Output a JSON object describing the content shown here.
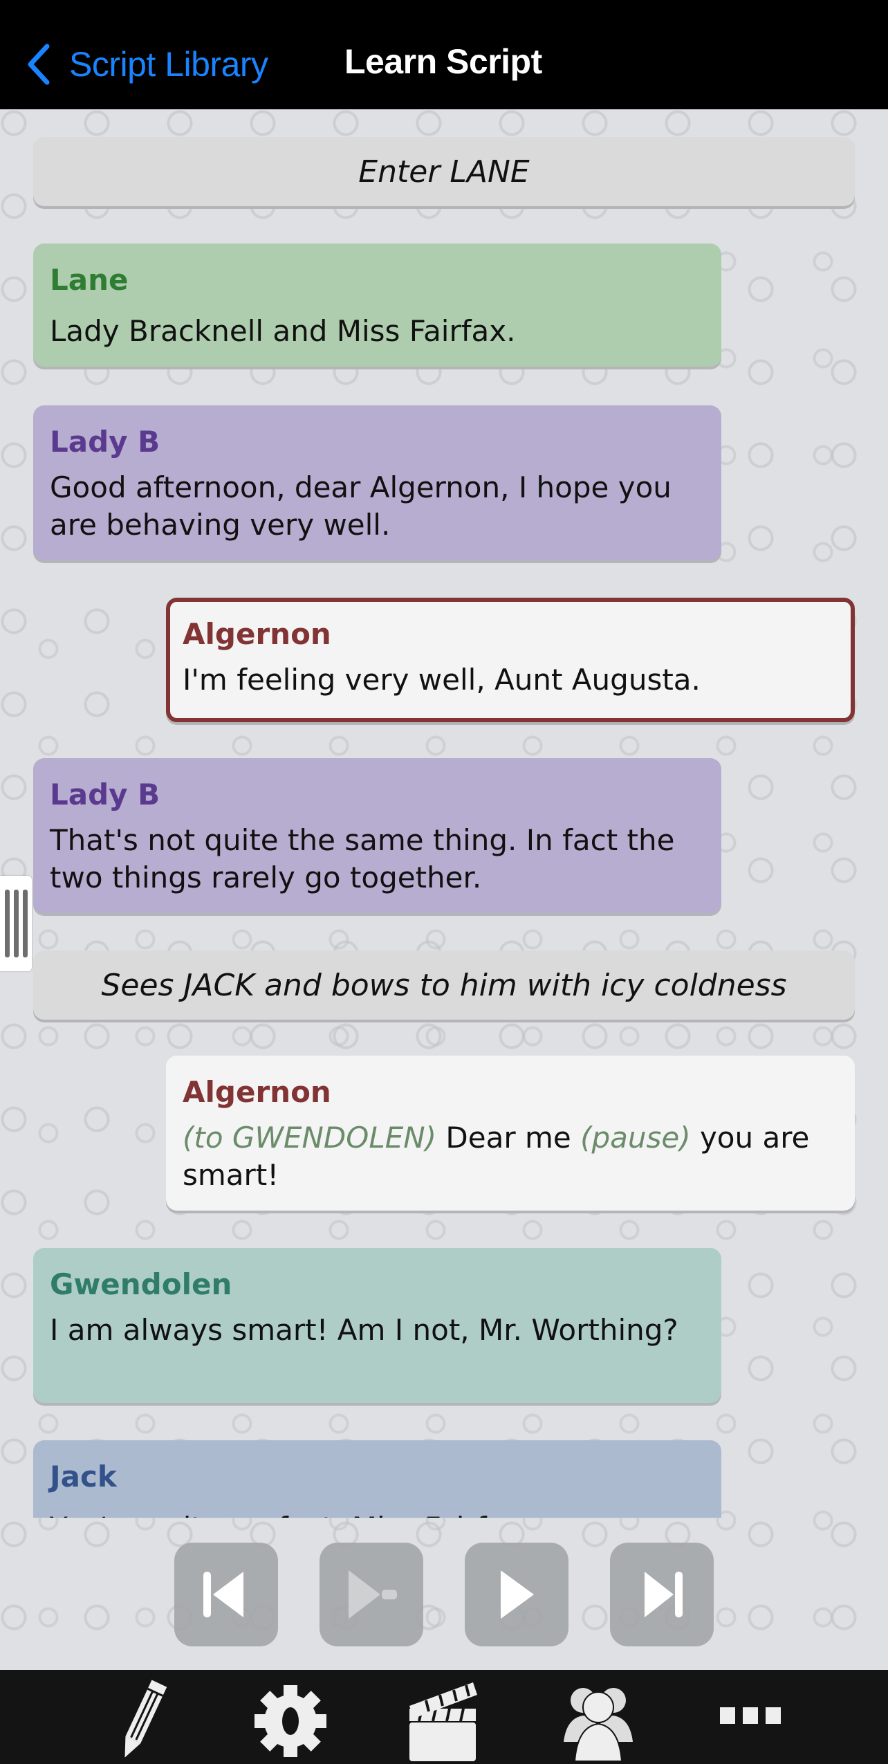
{
  "navbar": {
    "back_label": "Script Library",
    "title": "Learn Script",
    "accent_color": "#1a84ff"
  },
  "script": {
    "stage_directions": [
      {
        "text": "Enter LANE"
      },
      {
        "text": "Sees JACK and bows to him with icy coldness"
      }
    ],
    "lines": [
      {
        "character": "Lane",
        "text": "Lady Bracknell and Miss Fairfax.",
        "color": "#2e7d32",
        "bg": "#aecdae"
      },
      {
        "character": "Lady B",
        "text": "Good afternoon, dear Algernon, I hope you are behaving very well.",
        "color": "#5a3a8e",
        "bg": "#b7add0"
      },
      {
        "character": "Algernon",
        "text": "I'm feeling very well, Aunt Augusta.",
        "color": "#823333",
        "bg": "#f4f4f4",
        "current": true
      },
      {
        "character": "Lady B",
        "text": "That's not quite the same thing. In fact the two things rarely go together.",
        "color": "#5a3a8e",
        "bg": "#b7add0"
      },
      {
        "character": "Algernon",
        "direction1": "(to GWENDOLEN)",
        "text1": " Dear me ",
        "direction2": "(pause)",
        "text2": " you are smart!",
        "color": "#823333",
        "bg": "#f4f4f4"
      },
      {
        "character": "Gwendolen",
        "text": "I am always smart! Am I not, Mr. Worthing?",
        "color": "#2f7c6a",
        "bg": "#aecdc7"
      },
      {
        "character": "Jack",
        "text": "You're quite perfect, Miss Fairfax.",
        "color": "#33518a",
        "bg": "#acbacf"
      }
    ]
  },
  "controls": {
    "previous": "skip-back-icon",
    "play_cue": "play-cue-icon",
    "play": "play-icon",
    "next": "skip-forward-icon"
  },
  "tabbar": {
    "items": [
      "pencil-icon",
      "gear-icon",
      "clapperboard-icon",
      "people-icon",
      "more-icon"
    ]
  }
}
